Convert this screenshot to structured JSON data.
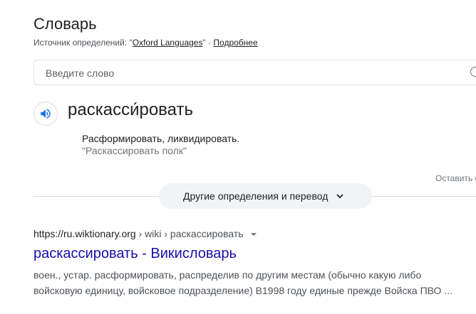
{
  "dictionary": {
    "title": "Словарь",
    "source_prefix": "Источник определений: \"",
    "source_name": "Oxford Languages",
    "source_suffix": "\" · ",
    "more_link": "Подробнее",
    "search_placeholder": "Введите слово",
    "word": "раскасси́ровать",
    "definition": "Расформировать, ликвидировать.",
    "example": "\"Раскассировать полк\"",
    "feedback": "Оставить отзыв",
    "more_button": "Другие определения и перевод"
  },
  "result": {
    "domain": "https://ru.wiktionary.org",
    "path": " › wiki › раскассировать",
    "title": "раскассировать - Викисловарь",
    "snippet_line1": "воен., устар. расформировать, распределив по другим местам (обычно какую либо",
    "snippet_line2": "войсковую единицу, войсковое подразделение) В1998 году единые прежде Войска ПВО ..."
  },
  "colors": {
    "link": "#1a0dab",
    "speaker_icon": "#1a73e8"
  }
}
